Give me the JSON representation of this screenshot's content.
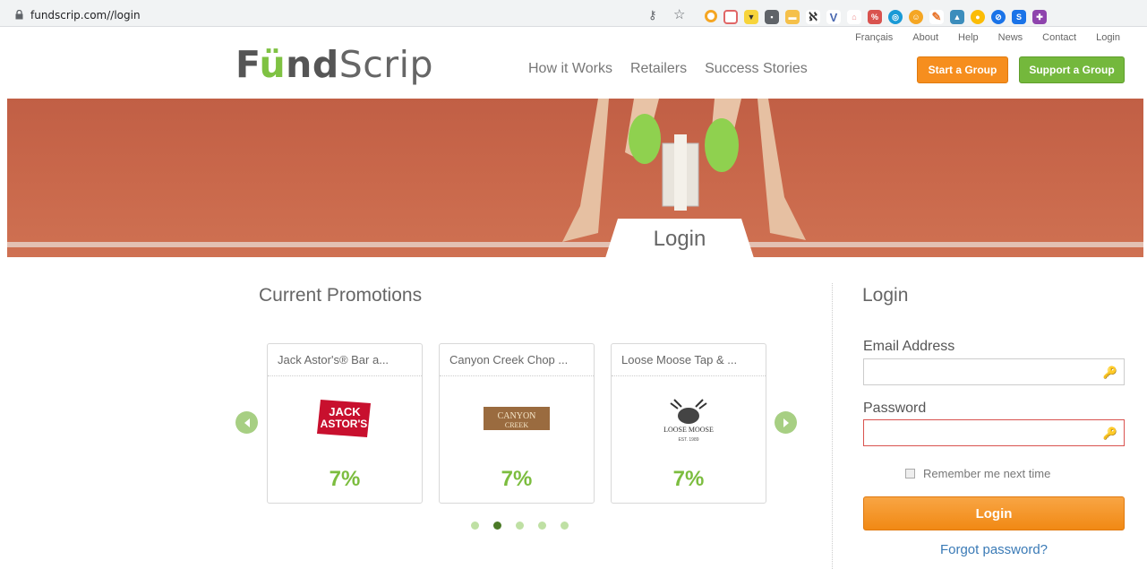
{
  "browser": {
    "url": "fundscrip.com//login"
  },
  "header": {
    "top_links": [
      "Français",
      "About",
      "Help",
      "News",
      "Contact",
      "Login"
    ],
    "logo": {
      "f": "F",
      "u": "ü",
      "nd": "nd",
      "scrip": "Scrip"
    },
    "nav": [
      "How it Works",
      "Retailers",
      "Success Stories"
    ],
    "start_group": "Start a Group",
    "support_group": "Support a Group"
  },
  "banner": {
    "tab_label": "Login"
  },
  "promotions": {
    "title": "Current Promotions",
    "cards": [
      {
        "title": "Jack Astor's® Bar a...",
        "logo_name": "jack-astors-logo",
        "percent": "7%"
      },
      {
        "title": "Canyon Creek Chop ...",
        "logo_name": "canyon-creek-logo",
        "percent": "7%"
      },
      {
        "title": "Loose Moose Tap & ...",
        "logo_name": "loose-moose-logo",
        "percent": "7%"
      }
    ],
    "active_page": 2,
    "page_count": 5
  },
  "login_form": {
    "title": "Login",
    "email_label": "Email Address",
    "email_value": "",
    "password_label": "Password",
    "password_value": "",
    "remember_label": "Remember me next time",
    "submit_label": "Login",
    "forgot_label": "Forgot password?"
  },
  "colors": {
    "orange": "#f68e1e",
    "green": "#74b83c",
    "track": "#c9684b",
    "percent": "#7cbd3f",
    "link": "#3a7ab6"
  }
}
